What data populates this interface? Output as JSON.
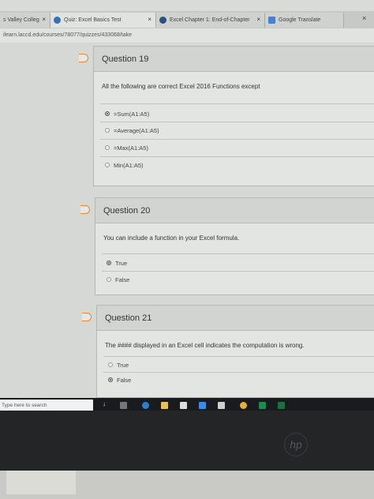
{
  "browser": {
    "tabs": [
      {
        "label": "s Valley Colleg",
        "close": "×"
      },
      {
        "label": "Quiz: Excel Basics Test",
        "close": "×"
      },
      {
        "label": "Excel Chapter 1: End-of-Chapter",
        "close": "×"
      },
      {
        "label": "Google Translate",
        "close": ""
      }
    ],
    "window_close": "×",
    "url": "ilearn.laccd.edu/courses/78077/quizzes/433068/take"
  },
  "questions": [
    {
      "title": "Question 19",
      "prompt": "All the following are correct Excel 2016 Functions except",
      "answers": [
        {
          "label": "=Sum(A1:A5)",
          "selected": true
        },
        {
          "label": "=Average(A1:A5)",
          "selected": false
        },
        {
          "label": "=Max(A1:A5)",
          "selected": false
        },
        {
          "label": "Min(A1:A5)",
          "selected": false
        }
      ]
    },
    {
      "title": "Question 20",
      "prompt": "You can include a function in your Excel formula.",
      "answers": [
        {
          "label": "True",
          "selected": true
        },
        {
          "label": "False",
          "selected": false
        }
      ]
    },
    {
      "title": "Question 21",
      "prompt": "The #### displayed in an Excel cell indicates the computation  is wrong.",
      "answers": [
        {
          "label": "True",
          "selected": false
        },
        {
          "label": "False",
          "selected": true
        }
      ]
    }
  ],
  "taskbar": {
    "search_placeholder": "Type here to search"
  },
  "colors": {
    "flag": "#e08a38",
    "taskbar": "#191b1e"
  }
}
